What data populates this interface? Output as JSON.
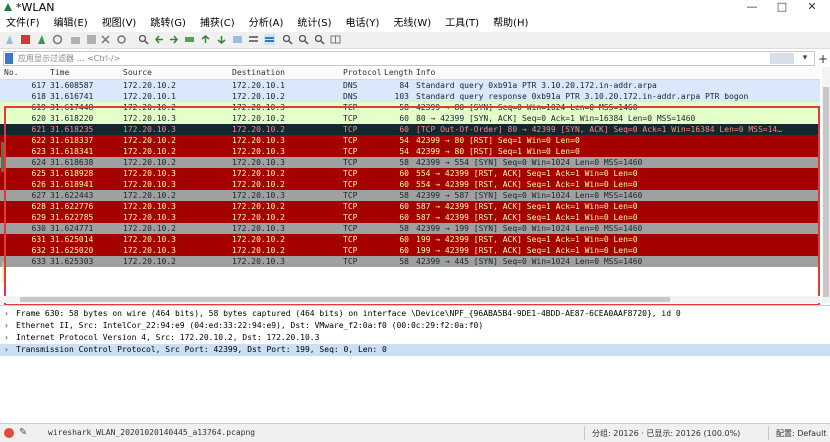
{
  "window": {
    "title": "*WLAN",
    "controls": {
      "minimize": "—",
      "maximize": "□",
      "close": "✕"
    }
  },
  "menu": [
    "文件(F)",
    "编辑(E)",
    "视图(V)",
    "跳转(G)",
    "捕获(C)",
    "分析(A)",
    "统计(S)",
    "电话(Y)",
    "无线(W)",
    "工具(T)",
    "帮助(H)"
  ],
  "filter": {
    "placeholder": "应用显示过滤器 … <Ctrl-/>",
    "dropdown": "▾",
    "add": "+"
  },
  "columns": {
    "no": "No.",
    "time": "Time",
    "source": "Source",
    "destination": "Destination",
    "protocol": "Protocol",
    "length": "Length",
    "info": "Info"
  },
  "packets": [
    {
      "no": "617",
      "time": "31.608587",
      "src": "172.20.10.2",
      "dst": "172.20.10.1",
      "proto": "DNS",
      "len": "84",
      "info": "Standard query 0xb91a PTR 3.10.20.172.in-addr.arpa",
      "bg": "#dae8fc",
      "fg": "#12272e"
    },
    {
      "no": "618",
      "time": "31.616741",
      "src": "172.20.10.1",
      "dst": "172.20.10.2",
      "proto": "DNS",
      "len": "103",
      "info": "Standard query response 0xb91a PTR 3.10.20.172.in-addr.arpa PTR bogon",
      "bg": "#dae8fc",
      "fg": "#12272e"
    },
    {
      "no": "619",
      "time": "31.617448",
      "src": "172.20.10.2",
      "dst": "172.20.10.3",
      "proto": "TCP",
      "len": "58",
      "info": "42399 → 80 [SYN] Seq=0 Win=1024 Len=0 MSS=1460",
      "bg": "#e4ffc7",
      "fg": "#12272e"
    },
    {
      "no": "620",
      "time": "31.618220",
      "src": "172.20.10.3",
      "dst": "172.20.10.2",
      "proto": "TCP",
      "len": "60",
      "info": "80 → 42399 [SYN, ACK] Seq=0 Ack=1 Win=16384 Len=0 MSS=1460",
      "bg": "#e4ffc7",
      "fg": "#12272e"
    },
    {
      "no": "621",
      "time": "31.618235",
      "src": "172.20.10.3",
      "dst": "172.20.10.2",
      "proto": "TCP",
      "len": "60",
      "info": "[TCP Out-Of-Order] 80 → 42399 [SYN, ACK] Seq=0 Ack=1 Win=16384 Len=0 MSS=14…",
      "bg": "#12272e",
      "fg": "#f78787"
    },
    {
      "no": "622",
      "time": "31.618337",
      "src": "172.20.10.2",
      "dst": "172.20.10.3",
      "proto": "TCP",
      "len": "54",
      "info": "42399 → 80 [RST] Seq=1 Win=0 Len=0",
      "bg": "#a40000",
      "fg": "#fffc9c"
    },
    {
      "no": "623",
      "time": "31.618341",
      "src": "172.20.10.2",
      "dst": "172.20.10.3",
      "proto": "TCP",
      "len": "54",
      "info": "42399 → 80 [RST] Seq=1 Win=0 Len=0",
      "bg": "#a40000",
      "fg": "#fffc9c"
    },
    {
      "no": "624",
      "time": "31.618638",
      "src": "172.20.10.2",
      "dst": "172.20.10.3",
      "proto": "TCP",
      "len": "58",
      "info": "42399 → 554 [SYN] Seq=0 Win=1024 Len=0 MSS=1460",
      "bg": "#a0a0a0",
      "fg": "#12272e"
    },
    {
      "no": "625",
      "time": "31.618928",
      "src": "172.20.10.3",
      "dst": "172.20.10.2",
      "proto": "TCP",
      "len": "60",
      "info": "554 → 42399 [RST, ACK] Seq=1 Ack=1 Win=0 Len=0",
      "bg": "#a40000",
      "fg": "#fffc9c"
    },
    {
      "no": "626",
      "time": "31.618941",
      "src": "172.20.10.3",
      "dst": "172.20.10.2",
      "proto": "TCP",
      "len": "60",
      "info": "554 → 42399 [RST, ACK] Seq=1 Ack=1 Win=0 Len=0",
      "bg": "#a40000",
      "fg": "#fffc9c"
    },
    {
      "no": "627",
      "time": "31.622443",
      "src": "172.20.10.2",
      "dst": "172.20.10.3",
      "proto": "TCP",
      "len": "58",
      "info": "42399 → 587 [SYN] Seq=0 Win=1024 Len=0 MSS=1460",
      "bg": "#a0a0a0",
      "fg": "#12272e"
    },
    {
      "no": "628",
      "time": "31.622776",
      "src": "172.20.10.3",
      "dst": "172.20.10.2",
      "proto": "TCP",
      "len": "60",
      "info": "587 → 42399 [RST, ACK] Seq=1 Ack=1 Win=0 Len=0",
      "bg": "#a40000",
      "fg": "#fffc9c"
    },
    {
      "no": "629",
      "time": "31.622785",
      "src": "172.20.10.3",
      "dst": "172.20.10.2",
      "proto": "TCP",
      "len": "60",
      "info": "587 → 42399 [RST, ACK] Seq=1 Ack=1 Win=0 Len=0",
      "bg": "#a40000",
      "fg": "#fffc9c"
    },
    {
      "no": "630",
      "time": "31.624771",
      "src": "172.20.10.2",
      "dst": "172.20.10.3",
      "proto": "TCP",
      "len": "58",
      "info": "42399 → 199 [SYN] Seq=0 Win=1024 Len=0 MSS=1460",
      "bg": "#a0a0a0",
      "fg": "#12272e"
    },
    {
      "no": "631",
      "time": "31.625014",
      "src": "172.20.10.3",
      "dst": "172.20.10.2",
      "proto": "TCP",
      "len": "60",
      "info": "199 → 42399 [RST, ACK] Seq=1 Ack=1 Win=0 Len=0",
      "bg": "#a40000",
      "fg": "#fffc9c"
    },
    {
      "no": "632",
      "time": "31.625020",
      "src": "172.20.10.3",
      "dst": "172.20.10.2",
      "proto": "TCP",
      "len": "60",
      "info": "199 → 42399 [RST, ACK] Seq=1 Ack=1 Win=0 Len=0",
      "bg": "#a40000",
      "fg": "#fffc9c"
    },
    {
      "no": "633",
      "time": "31.625303",
      "src": "172.20.10.2",
      "dst": "172.20.10.3",
      "proto": "TCP",
      "len": "58",
      "info": "42399 → 445 [SYN] Seq=0 Win=1024 Len=0 MSS=1460",
      "bg": "#a0a0a0",
      "fg": "#12272e"
    }
  ],
  "details": [
    {
      "arrow": "›",
      "text": "Frame 630: 58 bytes on wire (464 bits), 58 bytes captured (464 bits) on interface \\Device\\NPF_{96ABA5B4-9DE1-4BDD-AE87-6CEA0AAF8720}, id 0",
      "selected": false
    },
    {
      "arrow": "›",
      "text": "Ethernet II, Src: IntelCor_22:94:e9 (04:ed:33:22:94:e9), Dst: VMware_f2:0a:f0 (00:0c:29:f2:0a:f0)",
      "selected": false
    },
    {
      "arrow": "›",
      "text": "Internet Protocol Version 4, Src: 172.20.10.2, Dst: 172.20.10.3",
      "selected": false
    },
    {
      "arrow": "›",
      "text": "Transmission Control Protocol, Src Port: 42399, Dst Port: 199, Seq: 0, Len: 0",
      "selected": true
    }
  ],
  "status": {
    "file": "wireshark_WLAN_20201020140445_a13764.pcapng",
    "stats": "分组: 20126 · 已显示: 20126 (100.0%)",
    "profile": "配置: Default"
  },
  "colors": {
    "selection_border": "#e03a3a",
    "detail_selected": "#cce0f5"
  }
}
